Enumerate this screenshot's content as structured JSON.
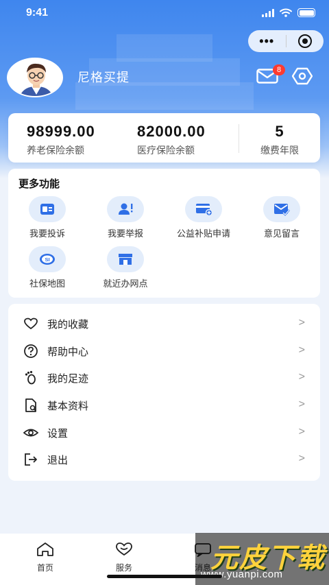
{
  "status_bar": {
    "time": "9:41"
  },
  "user": {
    "name": "尼格买提",
    "unread_count": "8"
  },
  "stats": [
    {
      "value": "98999.00",
      "label": "养老保险余额"
    },
    {
      "value": "82000.00",
      "label": "医疗保险余额"
    },
    {
      "value": "5",
      "label": "缴费年限"
    }
  ],
  "functions": {
    "title": "更多功能",
    "items": [
      {
        "label": "我要投诉",
        "icon": "complaint-icon"
      },
      {
        "label": "我要举报",
        "icon": "report-icon"
      },
      {
        "label": "公益补贴申请",
        "icon": "subsidy-card-icon"
      },
      {
        "label": "意见留言",
        "icon": "feedback-mail-icon"
      },
      {
        "label": "社保地图",
        "icon": "social-security-map-icon"
      },
      {
        "label": "就近办网点",
        "icon": "service-outlet-icon"
      }
    ]
  },
  "menu": [
    {
      "label": "我的收藏",
      "icon": "heart-icon"
    },
    {
      "label": "帮助中心",
      "icon": "help-icon"
    },
    {
      "label": "我的足迹",
      "icon": "footprint-icon"
    },
    {
      "label": "基本资料",
      "icon": "profile-doc-icon"
    },
    {
      "label": "设置",
      "icon": "eye-settings-icon"
    },
    {
      "label": "退出",
      "icon": "logout-icon"
    }
  ],
  "tabbar": [
    {
      "label": "首页",
      "icon": "home-icon"
    },
    {
      "label": "服务",
      "icon": "heart-service-icon"
    },
    {
      "label": "消息",
      "icon": "message-icon"
    }
  ],
  "watermark": {
    "text": "元皮下载",
    "url": "www.yuanpi.com"
  },
  "colors": {
    "accent": "#3f86ee",
    "icon_bg": "#e3edfb",
    "badge": "#ff3b30"
  }
}
